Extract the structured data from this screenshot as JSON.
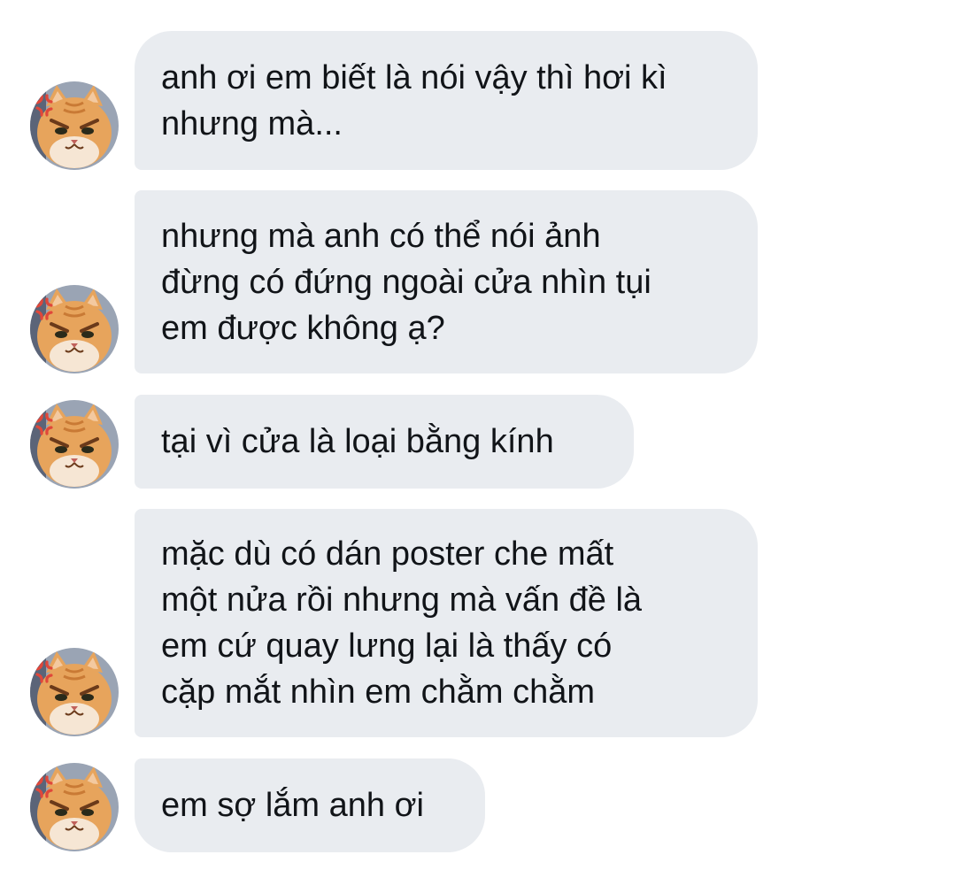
{
  "messages": [
    {
      "text": "anh ơi em biết là nói vậy thì hơi kì\nnhưng mà..."
    },
    {
      "text": "nhưng mà anh có thể nói ảnh\nđừng có đứng ngoài cửa nhìn tụi\nem được không ạ?"
    },
    {
      "text": "tại vì cửa là loại bằng kính"
    },
    {
      "text": "mặc dù có dán poster che mất\nmột nửa rồi nhưng mà vấn đề là\nem cứ quay lưng lại là thấy có\ncặp mắt nhìn em chằm chằm"
    },
    {
      "text": "em sợ lắm anh ơi"
    }
  ],
  "avatar": {
    "icon": "angry-cat-avatar-icon"
  },
  "colors": {
    "bubble_bg": "#e9ecf0",
    "text": "#111418",
    "cat_orange": "#e7a45c",
    "anger_mark": "#e0473a"
  }
}
